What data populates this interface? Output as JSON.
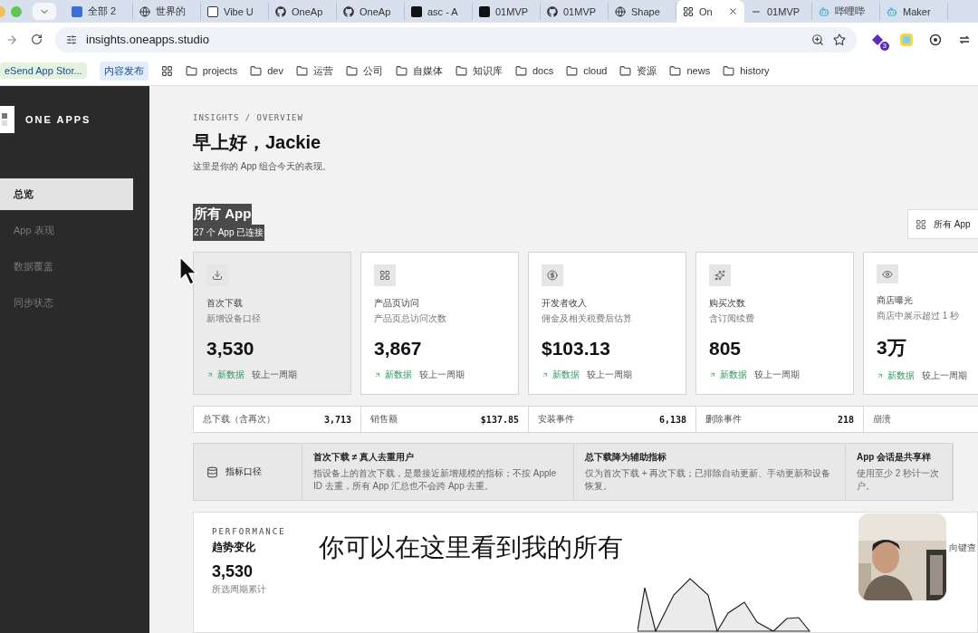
{
  "browser": {
    "tabs": [
      {
        "label": "全部 2",
        "kind": "doc",
        "selected": false
      },
      {
        "label": "世界的",
        "kind": "globe",
        "selected": false
      },
      {
        "label": "Vibe U",
        "kind": "square",
        "selected": false
      },
      {
        "label": "OneAp",
        "kind": "github",
        "selected": false
      },
      {
        "label": "OneAp",
        "kind": "github",
        "selected": false
      },
      {
        "label": "asc - A",
        "kind": "dark",
        "selected": false
      },
      {
        "label": "01MVP",
        "kind": "dark",
        "selected": false
      },
      {
        "label": "01MVP",
        "kind": "github",
        "selected": false
      },
      {
        "label": "Shape",
        "kind": "globe",
        "selected": false
      },
      {
        "label": "On",
        "kind": "grid",
        "selected": true
      },
      {
        "label": "01MVP",
        "kind": "minus",
        "selected": false
      },
      {
        "label": "哔哩哔",
        "kind": "bot",
        "selected": false
      },
      {
        "label": "Maker",
        "kind": "bot",
        "selected": false
      }
    ],
    "address": "insights.oneapps.studio",
    "extension_badge": "3",
    "bookmarks": [
      {
        "label": "eSend App Stor...",
        "kind": "app"
      },
      {
        "label": "内容发布",
        "kind": "app"
      },
      {
        "label": "projects",
        "kind": "folder"
      },
      {
        "label": "dev",
        "kind": "folder"
      },
      {
        "label": "运营",
        "kind": "folder"
      },
      {
        "label": "公司",
        "kind": "folder"
      },
      {
        "label": "自媒体",
        "kind": "folder"
      },
      {
        "label": "知识库",
        "kind": "folder"
      },
      {
        "label": "docs",
        "kind": "folder"
      },
      {
        "label": "cloud",
        "kind": "folder"
      },
      {
        "label": "资源",
        "kind": "folder"
      },
      {
        "label": "news",
        "kind": "folder"
      },
      {
        "label": "history",
        "kind": "folder"
      }
    ]
  },
  "sidebar": {
    "brand": "ONE APPS",
    "items": [
      {
        "label": "总览",
        "selected": true
      },
      {
        "label": "App 表现",
        "selected": false
      },
      {
        "label": "数据覆盖",
        "selected": false
      },
      {
        "label": "同步状态",
        "selected": false
      }
    ]
  },
  "header": {
    "breadcrumb": "INSIGHTS / OVERVIEW",
    "greeting": "早上好，Jackie",
    "subtitle": "这里是你的 App 组合今天的表现。"
  },
  "section": {
    "title": "所有 App",
    "subtitle": "27 个 App 已连接",
    "highlighted": true,
    "filter_label": "所有 App"
  },
  "metrics": [
    {
      "kind": "download",
      "title": "首次下载",
      "subtitle": "新增设备口径",
      "value": "3,530",
      "trend": "新数据",
      "comparison": "较上一周期",
      "selected": true
    },
    {
      "kind": "grid",
      "title": "产品页访问",
      "subtitle": "产品页总访问次数",
      "value": "3,867",
      "trend": "新数据",
      "comparison": "较上一周期",
      "selected": false
    },
    {
      "kind": "dollar",
      "title": "开发者收入",
      "subtitle": "佣金及相关税费后估算",
      "value": "$103.13",
      "trend": "新数据",
      "comparison": "较上一周期",
      "selected": false
    },
    {
      "kind": "sparkle",
      "title": "购买次数",
      "subtitle": "含订阅续费",
      "value": "805",
      "trend": "新数据",
      "comparison": "较上一周期",
      "selected": false
    },
    {
      "kind": "eye",
      "title": "商店曝光",
      "subtitle": "商店中展示超过 1 秒",
      "value": "3万",
      "trend": "新数据",
      "comparison": "较上一周期",
      "selected": false
    }
  ],
  "totals": [
    {
      "label": "总下载（含再次）",
      "value": "3,713"
    },
    {
      "label": "销售额",
      "value": "$137.85"
    },
    {
      "label": "安装事件",
      "value": "6,138"
    },
    {
      "label": "删除事件",
      "value": "218"
    },
    {
      "label": "崩溃"
    }
  ],
  "notes": {
    "label": "指标口径",
    "items": [
      {
        "title": "首次下载 ≠ 真人去重用户",
        "body": "指设备上的首次下载，是最接近新增规模的指标；不按 Apple ID 去重，所有 App 汇总也不会跨 App 去重。"
      },
      {
        "title": "总下载降为辅助指标",
        "body": "仅为首次下载 + 再次下载；已排除自动更新、手动更新和设备恢复。"
      },
      {
        "title": "App 会话是共享样",
        "body": "使用至少 2 秒计一次户。"
      }
    ]
  },
  "performance": {
    "eyebrow": "PERFORMANCE",
    "title": "趋势变化",
    "value": "3,530",
    "caption": "所选周期累计",
    "hint": "向键查"
  },
  "video_caption": "你可以在这里看到我的所有"
}
